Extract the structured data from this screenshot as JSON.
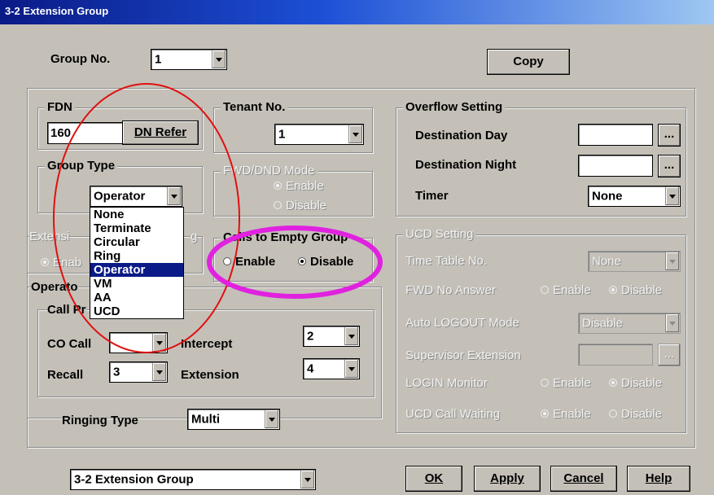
{
  "title": "3-2 Extension Group",
  "group_no": {
    "label": "Group No.",
    "value": "1"
  },
  "copy_button": "Copy",
  "fdn": {
    "label": "FDN",
    "value": "160",
    "dn_refer": "DN Refer"
  },
  "tenant": {
    "label": "Tenant No.",
    "value": "1"
  },
  "group_type": {
    "label": "Group Type",
    "value": "Operator",
    "options": [
      "None",
      "Terminate",
      "Circular",
      "Ring",
      "Operator",
      "VM",
      "AA",
      "UCD"
    ],
    "selected_index": 4
  },
  "fwd_dnd": {
    "label": "FWD/DND Mode",
    "enable": "Enable",
    "disable": "Disable"
  },
  "extension_group_partial": {
    "label": "Extensi",
    "label_tail": "g",
    "enable_partial": "Enab"
  },
  "calls_empty": {
    "label": "Calls to Empty Group",
    "enable": "Enable",
    "disable": "Disable",
    "selected": "Disable"
  },
  "operator": {
    "label": "Operato",
    "call_priority": "Call Pr",
    "co_call": "CO Call",
    "intercept": "Intercept",
    "intercept_value": "2",
    "recall": "Recall",
    "recall_value": "3",
    "extension": "Extension",
    "extension_value": "4"
  },
  "ringing_type": {
    "label": "Ringing Type",
    "value": "Multi"
  },
  "overflow": {
    "label": "Overflow Setting",
    "dest_day": "Destination Day",
    "dest_night": "Destination Night",
    "timer": "Timer",
    "timer_value": "None",
    "browse": "..."
  },
  "ucd": {
    "label": "UCD Setting",
    "time_table": "Time Table No.",
    "time_table_value": "None",
    "fwd_no_answer": "FWD No Answer",
    "auto_logout": "Auto LOGOUT Mode",
    "auto_logout_value": "Disable",
    "supervisor": "Supervisor Extension",
    "login_monitor": "LOGIN Monitor",
    "ucd_call_waiting": "UCD Call Waiting",
    "enable": "Enable",
    "disable": "Disable",
    "browse": "..."
  },
  "footer": {
    "selector_value": "3-2 Extension Group",
    "ok": "OK",
    "apply": "Apply",
    "cancel": "Cancel",
    "help": "Help"
  },
  "colors": {
    "title_bar": "#0a1a86",
    "face": "#c4c0b8",
    "annotation_red": "#e01010",
    "annotation_magenta": "#e022e0"
  }
}
